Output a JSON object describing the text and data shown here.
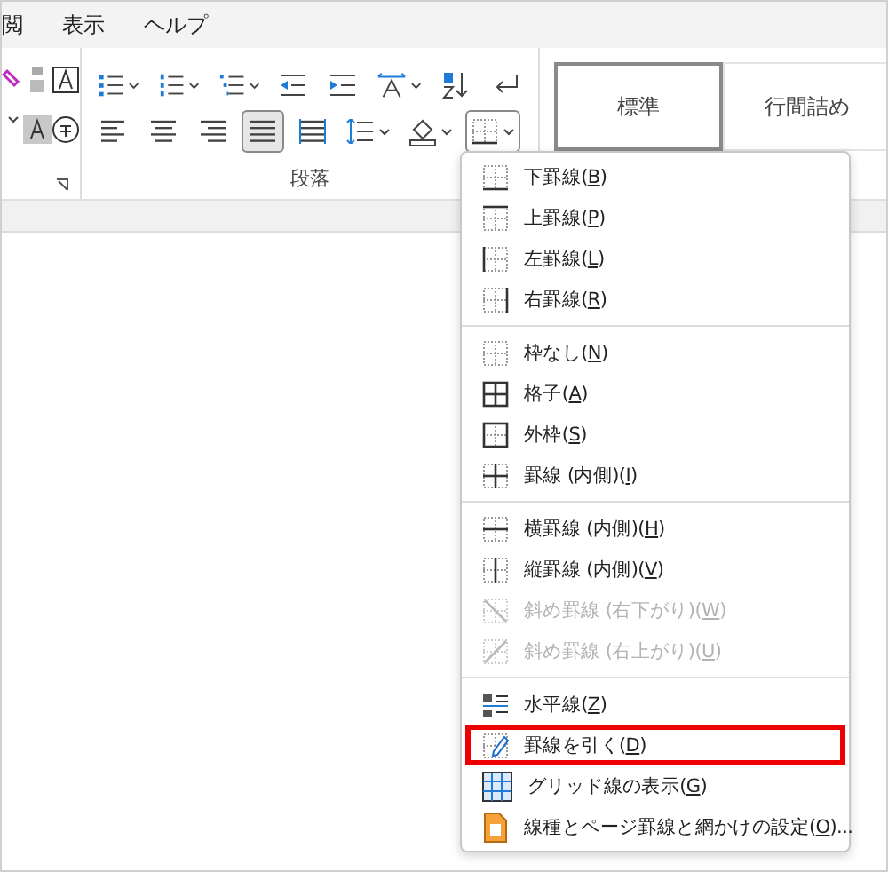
{
  "menu_bar": [
    "閲",
    "表示",
    "ヘルプ"
  ],
  "ribbon": {
    "align_buttons": [
      {
        "kind": "left",
        "selected": false
      },
      {
        "kind": "center",
        "selected": false
      },
      {
        "kind": "right",
        "selected": false
      },
      {
        "kind": "justify",
        "selected": true
      },
      {
        "kind": "distribute",
        "selected": false
      }
    ],
    "group_label": "段落",
    "styles": [
      {
        "label": "標準",
        "selected": true
      },
      {
        "label": "行間詰め",
        "selected": false
      }
    ]
  },
  "border_menu": {
    "sections": [
      [
        {
          "kind": "bottom",
          "before": "下罫線(",
          "key": "B",
          "after": ")",
          "disabled": false,
          "highlighted": false
        },
        {
          "kind": "top",
          "before": "上罫線(",
          "key": "P",
          "after": ")",
          "disabled": false,
          "highlighted": false
        },
        {
          "kind": "left",
          "before": "左罫線(",
          "key": "L",
          "after": ")",
          "disabled": false,
          "highlighted": false
        },
        {
          "kind": "right",
          "before": "右罫線(",
          "key": "R",
          "after": ")",
          "disabled": false,
          "highlighted": false
        }
      ],
      [
        {
          "kind": "none",
          "before": "枠なし(",
          "key": "N",
          "after": ")",
          "disabled": false,
          "highlighted": false
        },
        {
          "kind": "all",
          "before": "格子(",
          "key": "A",
          "after": ")",
          "disabled": false,
          "highlighted": false
        },
        {
          "kind": "outside",
          "before": "外枠(",
          "key": "S",
          "after": ")",
          "disabled": false,
          "highlighted": false
        },
        {
          "kind": "inside",
          "before": "罫線 (内側)(",
          "key": "I",
          "after": ")",
          "disabled": false,
          "highlighted": false
        }
      ],
      [
        {
          "kind": "inside-h",
          "before": "横罫線 (内側)(",
          "key": "H",
          "after": ")",
          "disabled": false,
          "highlighted": false
        },
        {
          "kind": "inside-v",
          "before": "縦罫線 (内側)(",
          "key": "V",
          "after": ")",
          "disabled": false,
          "highlighted": false
        },
        {
          "kind": "diag-down",
          "before": "斜め罫線 (右下がり)(",
          "key": "W",
          "after": ")",
          "disabled": true,
          "highlighted": false
        },
        {
          "kind": "diag-up",
          "before": "斜め罫線 (右上がり)(",
          "key": "U",
          "after": ")",
          "disabled": true,
          "highlighted": false
        }
      ],
      [
        {
          "kind": "hline",
          "before": "水平線(",
          "key": "Z",
          "after": ")",
          "disabled": false,
          "highlighted": false
        },
        {
          "kind": "draw",
          "before": "罫線を引く(",
          "key": "D",
          "after": ")",
          "disabled": false,
          "highlighted": true
        },
        {
          "kind": "grid",
          "before": "グリッド線の表示(",
          "key": "G",
          "after": ")",
          "disabled": false,
          "highlighted": false
        },
        {
          "kind": "page",
          "before": "線種とページ罫線と網かけの設定(",
          "key": "O",
          "after": ")...",
          "disabled": false,
          "highlighted": false
        }
      ]
    ]
  }
}
